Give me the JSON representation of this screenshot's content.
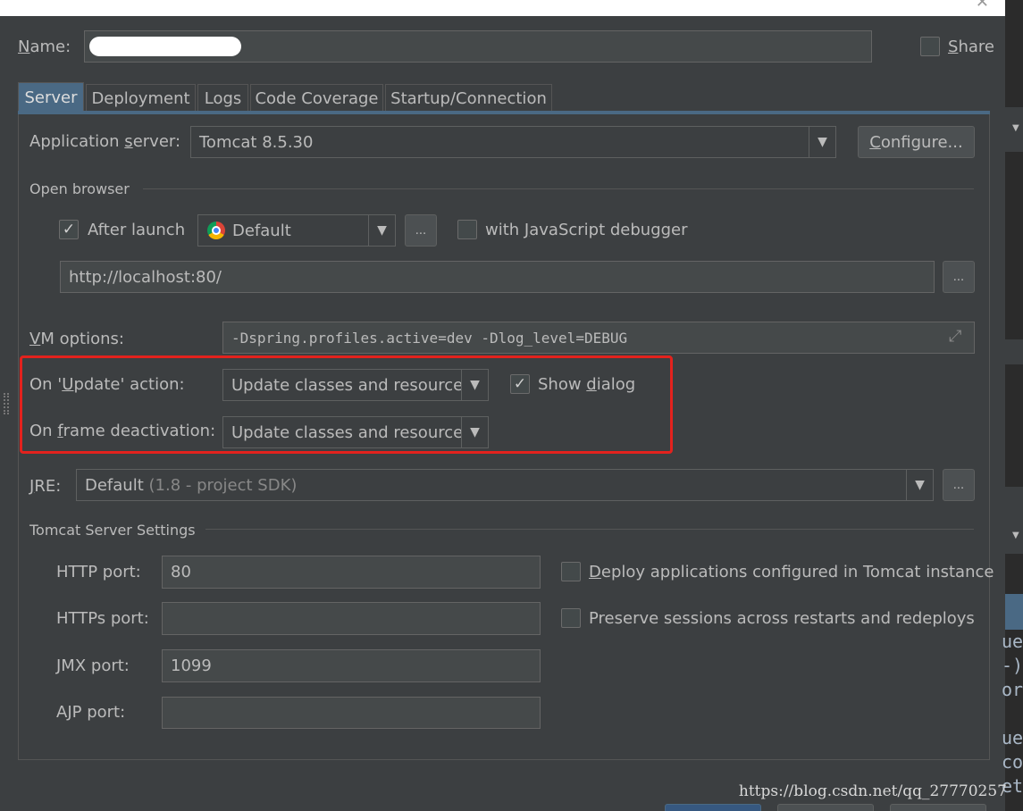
{
  "dialog": {
    "name_label": "Name:",
    "name_value": "",
    "share_label": "Share",
    "share_checked": false
  },
  "tabs": [
    {
      "label": "Server",
      "active": true
    },
    {
      "label": "Deployment",
      "active": false
    },
    {
      "label": "Logs",
      "active": false
    },
    {
      "label": "Code Coverage",
      "active": false
    },
    {
      "label": "Startup/Connection",
      "active": false
    }
  ],
  "server": {
    "app_server_label": "Application server:",
    "app_server_value": "Tomcat 8.5.30",
    "configure_button": "Configure...",
    "open_browser_title": "Open browser",
    "after_launch_label": "After launch",
    "after_launch_checked": true,
    "browser_value": "Default",
    "browse_button": "...",
    "js_debugger_label": "with JavaScript debugger",
    "js_debugger_checked": false,
    "url_value": "http://localhost:80/",
    "url_button": "...",
    "vm_options_label": "VM options:",
    "vm_options_value": "-Dspring.profiles.active=dev -Dlog_level=DEBUG",
    "on_update_label": "On 'Update' action:",
    "on_update_value": "Update classes and resources",
    "show_dialog_label": "Show dialog",
    "show_dialog_checked": true,
    "on_frame_label": "On frame deactivation:",
    "on_frame_value": "Update classes and resources",
    "jre_label": "JRE:",
    "jre_value": "Default",
    "jre_hint": "(1.8 - project SDK)",
    "jre_button": "...",
    "tomcat_settings_title": "Tomcat Server Settings",
    "http_port_label": "HTTP port:",
    "http_port_value": "80",
    "https_port_label": "HTTPs port:",
    "https_port_value": "",
    "jmx_port_label": "JMX port:",
    "jmx_port_value": "1099",
    "ajp_port_label": "AJP port:",
    "ajp_port_value": "",
    "deploy_apps_label": "Deploy applications configured in Tomcat instance",
    "deploy_apps_checked": false,
    "preserve_sessions_label": "Preserve sessions across restarts and redeploys",
    "preserve_sessions_checked": false
  },
  "background_code": [
    "ue",
    "-)",
    "or",
    "ue",
    "co",
    "et"
  ],
  "watermark": "https://blog.csdn.net/qq_27770257",
  "colors": {
    "background": "#3c3f41",
    "active_tab": "#4a6984",
    "highlight_box": "#e3221d",
    "text": "#bbbbbb"
  }
}
